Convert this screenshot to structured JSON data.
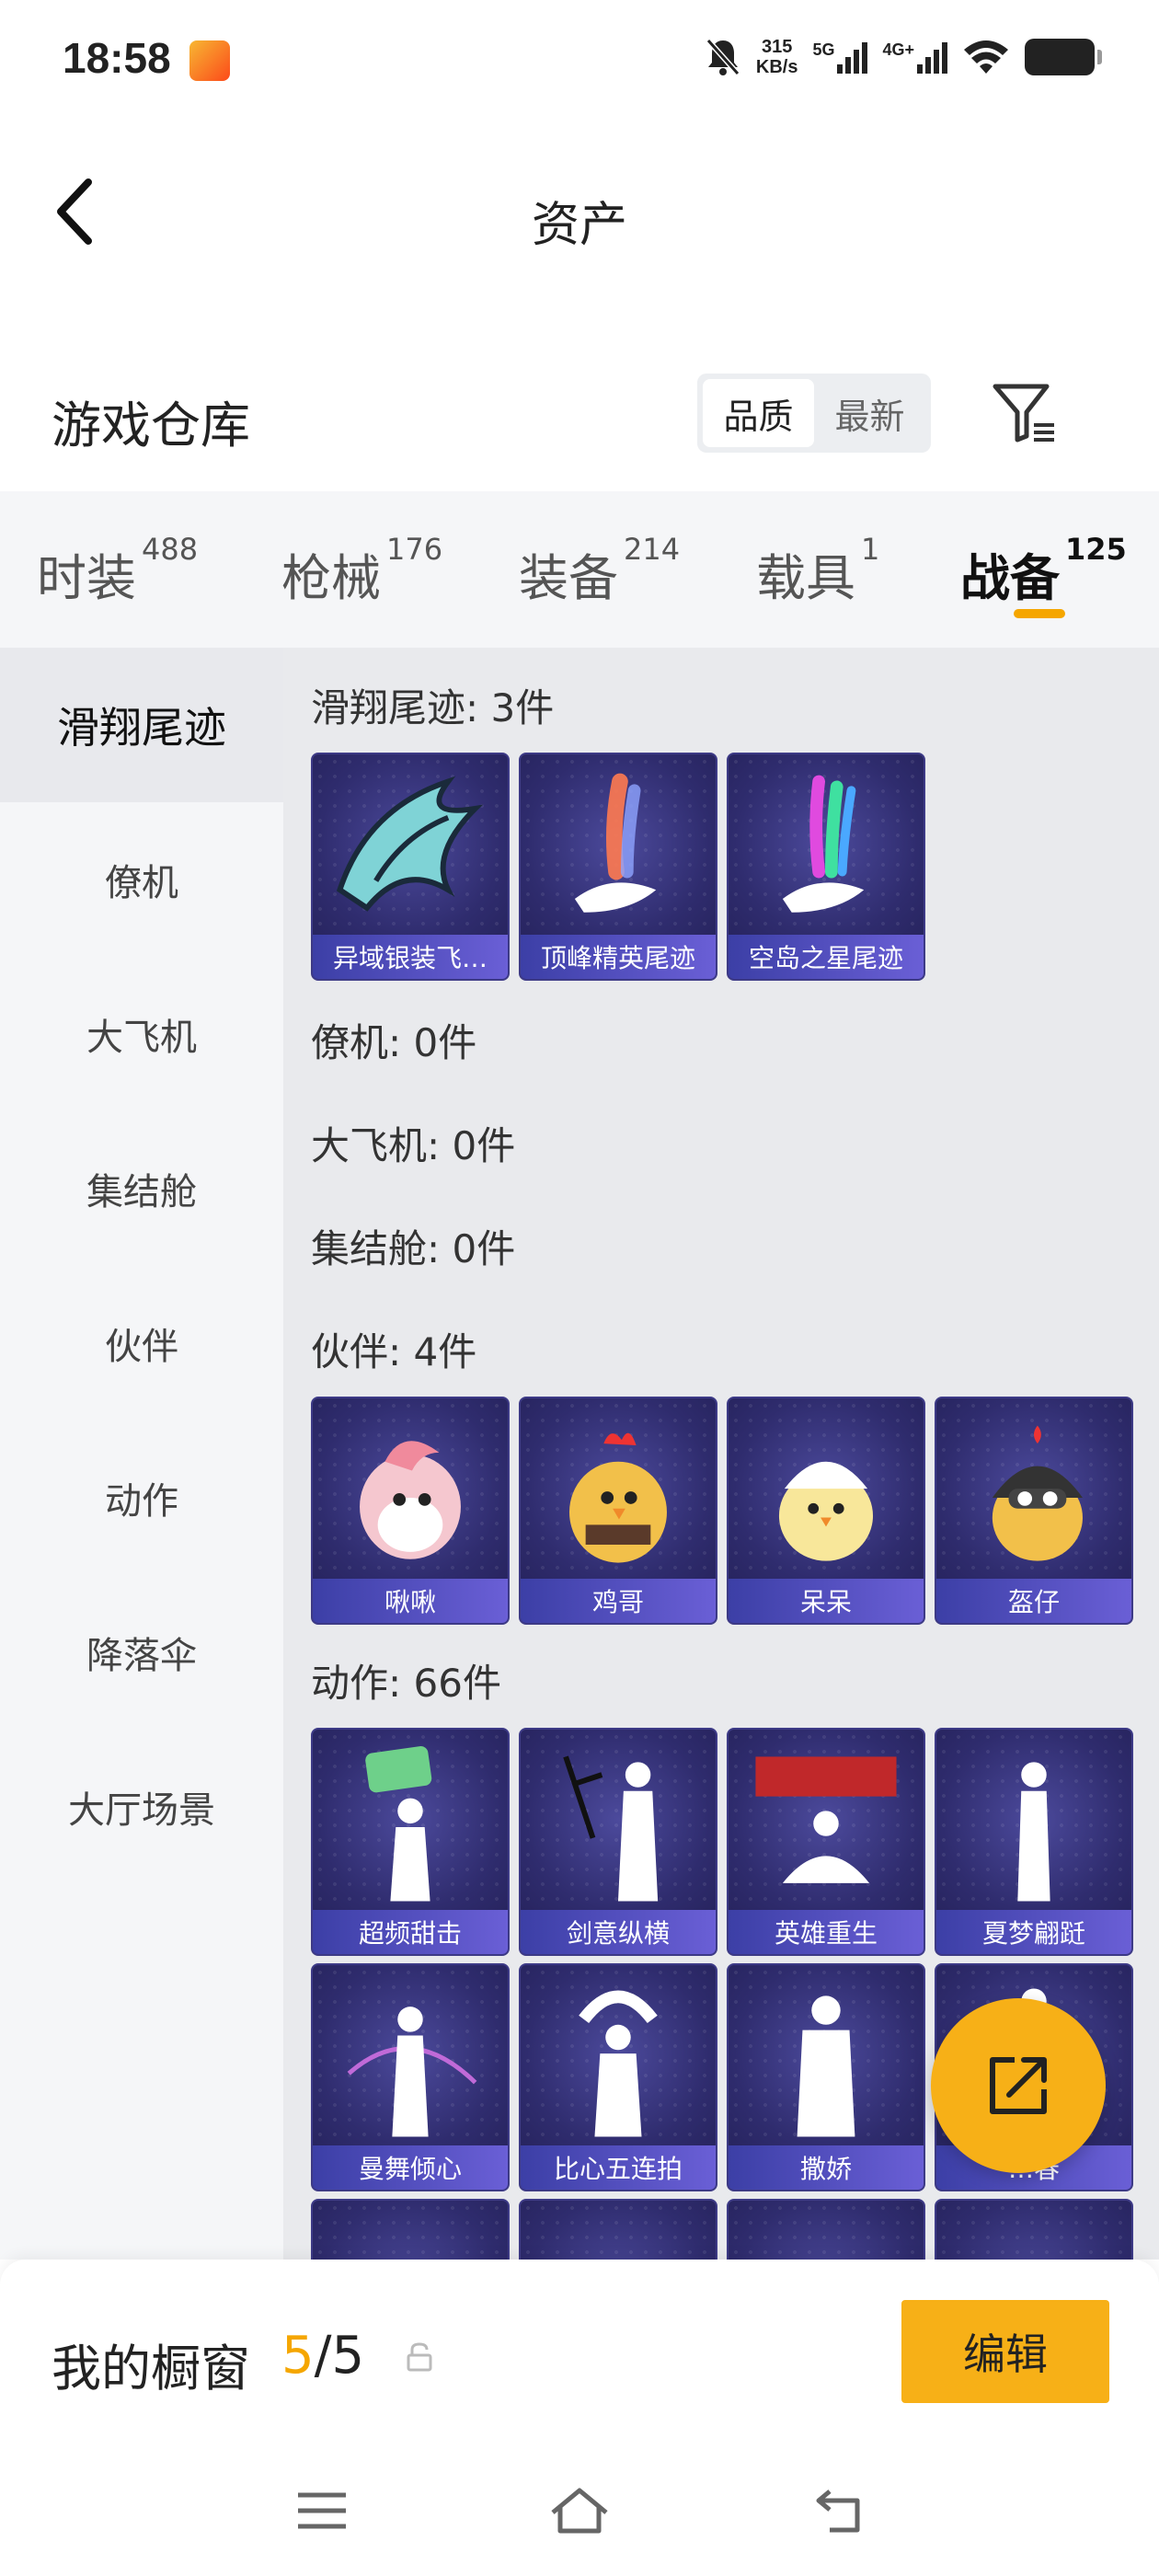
{
  "status": {
    "time": "18:58",
    "net_speed_value": "315",
    "net_speed_unit": "KB/s",
    "sim1": "5G",
    "sim2": "4G+"
  },
  "header": {
    "title": "资产"
  },
  "warehouse": {
    "title": "游戏仓库",
    "sort_quality": "品质",
    "sort_latest": "最新"
  },
  "tabs": [
    {
      "label": "时装",
      "count": "488"
    },
    {
      "label": "枪械",
      "count": "176"
    },
    {
      "label": "装备",
      "count": "214"
    },
    {
      "label": "载具",
      "count": "1"
    },
    {
      "label": "战备",
      "count": "125"
    }
  ],
  "sidebar": [
    "滑翔尾迹",
    "僚机",
    "大飞机",
    "集结舱",
    "伙伴",
    "动作",
    "降落伞",
    "大厅场景"
  ],
  "sections": {
    "trail": {
      "label": "滑翔尾迹: 3件",
      "items": [
        "异域银装飞…",
        "顶峰精英尾迹",
        "空岛之星尾迹"
      ]
    },
    "wingman": {
      "label": "僚机: 0件"
    },
    "plane": {
      "label": "大飞机: 0件"
    },
    "pod": {
      "label": "集结舱: 0件"
    },
    "buddy": {
      "label": "伙伴: 4件",
      "items": [
        "啾啾",
        "鸡哥",
        "呆呆",
        "盔仔"
      ]
    },
    "emote": {
      "label": "动作: 66件",
      "items": [
        "超频甜击",
        "剑意纵横",
        "英雄重生",
        "夏梦翩跹",
        "曼舞倾心",
        "比心五连拍",
        "撒娇",
        "…春"
      ]
    }
  },
  "bottom": {
    "window_label": "我的橱窗",
    "count_current": "5",
    "count_total": "/5",
    "edit_label": "编辑"
  },
  "colors": {
    "accent": "#f7b017",
    "card_bg": "#2f2c6e",
    "card_label": "#5a55cc"
  }
}
